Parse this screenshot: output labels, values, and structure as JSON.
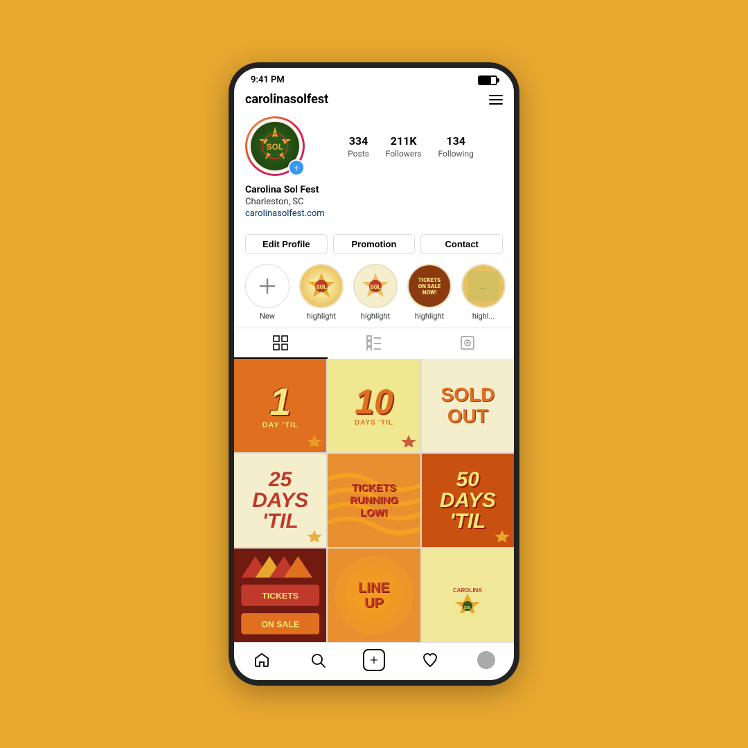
{
  "page": {
    "background_color": "#E8A830"
  },
  "status_bar": {
    "time": "9:41 PM"
  },
  "header": {
    "username": "carolinasolfest",
    "menu_label": "menu"
  },
  "profile": {
    "name": "Carolina Sol Fest",
    "location": "Charleston, SC",
    "website": "carolinasolfest.com",
    "stats": {
      "posts": {
        "count": "334",
        "label": "Posts"
      },
      "followers": {
        "count": "211K",
        "label": "Followers"
      },
      "following": {
        "count": "134",
        "label": "Following"
      }
    }
  },
  "buttons": {
    "edit_profile": "Edit Profile",
    "promotion": "Promotion",
    "contact": "Contact"
  },
  "stories": [
    {
      "label": "New",
      "type": "new"
    },
    {
      "label": "highlight",
      "type": "hl1"
    },
    {
      "label": "highlight",
      "type": "hl2"
    },
    {
      "label": "highlight",
      "type": "hl3"
    },
    {
      "label": "highl...",
      "type": "hl4"
    }
  ],
  "tabs": {
    "grid": "grid",
    "list": "list",
    "tagged": "tagged"
  },
  "grid_cells": [
    {
      "id": "cell-1",
      "type": "countdown1",
      "bg": "#e07020",
      "main": "1",
      "sub": "DAY 'TIL"
    },
    {
      "id": "cell-2",
      "type": "countdown10",
      "bg": "#f0e898",
      "main": "10",
      "sub": "DAYS 'TIL"
    },
    {
      "id": "cell-3",
      "type": "soldout",
      "bg": "#f5eecc",
      "main": "SOLD\nOUT",
      "sub": ""
    },
    {
      "id": "cell-4",
      "type": "countdown25",
      "bg": "#f5eecc",
      "main": "25\nDAYS\n'TIL",
      "sub": ""
    },
    {
      "id": "cell-5",
      "type": "ticketslow",
      "bg": "#e8a030",
      "main": "TICKETS\nRUNNING\nLOW!",
      "sub": ""
    },
    {
      "id": "cell-6",
      "type": "countdown50",
      "bg": "#d05010",
      "main": "50\nDAYS\n'TIL",
      "sub": ""
    },
    {
      "id": "cell-7",
      "type": "image1",
      "bg": "#8B1a1a",
      "main": "",
      "sub": ""
    },
    {
      "id": "cell-8",
      "type": "lineup",
      "bg": "#e8a030",
      "main": "LINE\nUP",
      "sub": ""
    },
    {
      "id": "cell-9",
      "type": "logo",
      "bg": "#f0e898",
      "main": "",
      "sub": ""
    }
  ],
  "bottom_nav": {
    "home": "home",
    "search": "search",
    "add": "add",
    "heart": "heart",
    "profile": "profile"
  }
}
